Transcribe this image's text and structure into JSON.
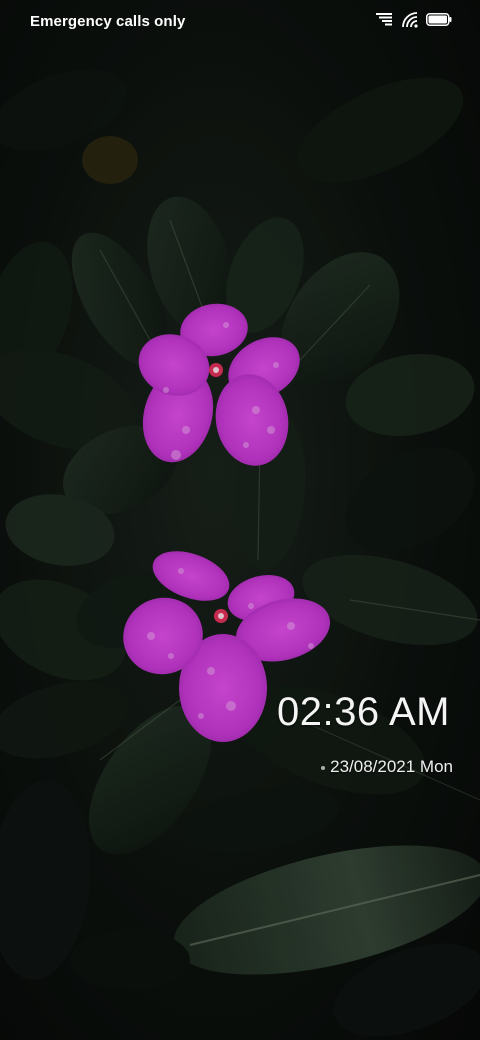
{
  "status_bar": {
    "carrier_text": "Emergency calls only",
    "icons": [
      "signal-bars-icon",
      "wifi-icon",
      "battery-icon"
    ],
    "battery_level": 1.0
  },
  "lockscreen": {
    "time": "02:36 AM",
    "date": "23/08/2021 Mon"
  },
  "colors": {
    "flower": "#c23bd1",
    "leaf": "#1c2a1f",
    "text": "#ffffff"
  }
}
